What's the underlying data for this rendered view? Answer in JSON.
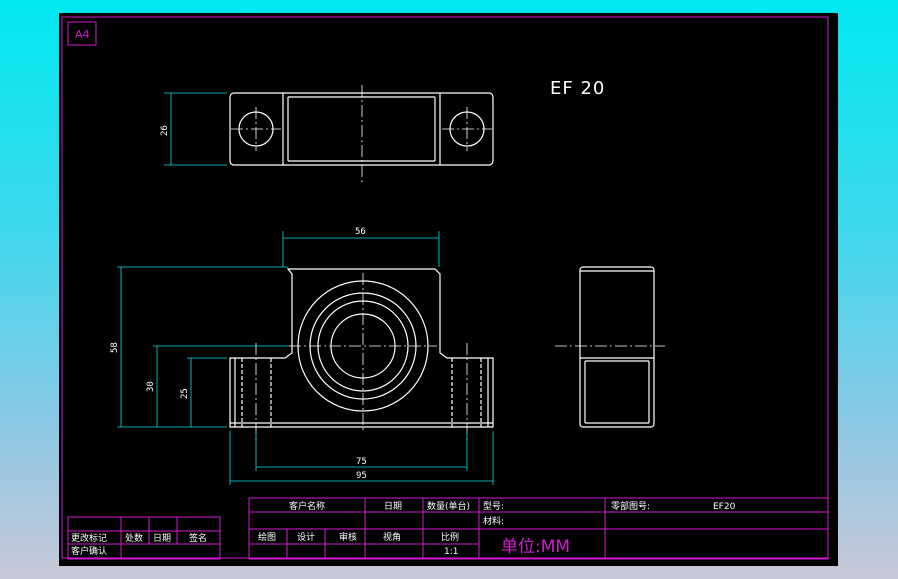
{
  "sheet": {
    "paper_size": "A4",
    "model_label": "EF 20"
  },
  "dimensions": {
    "top_height": "26",
    "top_width": "56",
    "total_height": "58",
    "center_height": "30",
    "base_height": "25",
    "hole_spacing": "75",
    "total_width": "95"
  },
  "title_block": {
    "customer_name": "客户名称",
    "date": "日期",
    "quantity": "数量(单台)",
    "model_no": "型号:",
    "drawing_no": "零部图号:",
    "drawing_no_value": "EF20",
    "material": "材料:",
    "drawn": "绘图",
    "design": "设计",
    "checked": "审核",
    "view_angle": "视角",
    "scale_label": "比例",
    "scale_value": "1:1",
    "unit": "单位:MM"
  },
  "revision_block": {
    "change_mark": "更改标记",
    "location": "处数",
    "date": "日期",
    "signature": "签名",
    "customer_confirm": "客户确认"
  },
  "colors": {
    "frame": "#d21ad2",
    "geometry": "#ffffff",
    "dimension": "#00e0e0",
    "background": "#000000"
  }
}
